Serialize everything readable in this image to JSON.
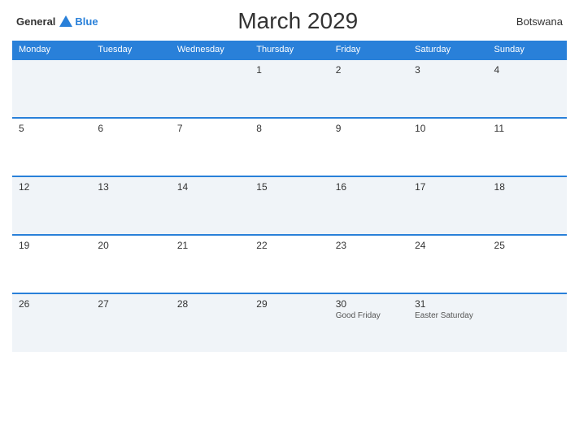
{
  "header": {
    "logo_general": "General",
    "logo_blue": "Blue",
    "title": "March 2029",
    "country": "Botswana"
  },
  "weekdays": [
    "Monday",
    "Tuesday",
    "Wednesday",
    "Thursday",
    "Friday",
    "Saturday",
    "Sunday"
  ],
  "weeks": [
    [
      {
        "day": "",
        "holiday": ""
      },
      {
        "day": "",
        "holiday": ""
      },
      {
        "day": "",
        "holiday": ""
      },
      {
        "day": "1",
        "holiday": ""
      },
      {
        "day": "2",
        "holiday": ""
      },
      {
        "day": "3",
        "holiday": ""
      },
      {
        "day": "4",
        "holiday": ""
      }
    ],
    [
      {
        "day": "5",
        "holiday": ""
      },
      {
        "day": "6",
        "holiday": ""
      },
      {
        "day": "7",
        "holiday": ""
      },
      {
        "day": "8",
        "holiday": ""
      },
      {
        "day": "9",
        "holiday": ""
      },
      {
        "day": "10",
        "holiday": ""
      },
      {
        "day": "11",
        "holiday": ""
      }
    ],
    [
      {
        "day": "12",
        "holiday": ""
      },
      {
        "day": "13",
        "holiday": ""
      },
      {
        "day": "14",
        "holiday": ""
      },
      {
        "day": "15",
        "holiday": ""
      },
      {
        "day": "16",
        "holiday": ""
      },
      {
        "day": "17",
        "holiday": ""
      },
      {
        "day": "18",
        "holiday": ""
      }
    ],
    [
      {
        "day": "19",
        "holiday": ""
      },
      {
        "day": "20",
        "holiday": ""
      },
      {
        "day": "21",
        "holiday": ""
      },
      {
        "day": "22",
        "holiday": ""
      },
      {
        "day": "23",
        "holiday": ""
      },
      {
        "day": "24",
        "holiday": ""
      },
      {
        "day": "25",
        "holiday": ""
      }
    ],
    [
      {
        "day": "26",
        "holiday": ""
      },
      {
        "day": "27",
        "holiday": ""
      },
      {
        "day": "28",
        "holiday": ""
      },
      {
        "day": "29",
        "holiday": ""
      },
      {
        "day": "30",
        "holiday": "Good Friday"
      },
      {
        "day": "31",
        "holiday": "Easter Saturday"
      },
      {
        "day": "",
        "holiday": ""
      }
    ]
  ]
}
